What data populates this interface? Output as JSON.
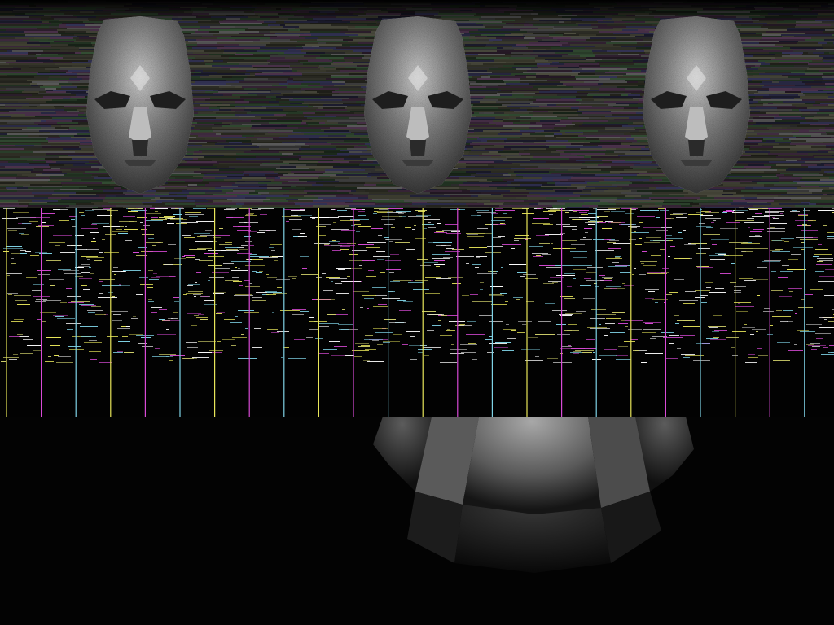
{
  "scene": {
    "mask_count": 3,
    "stripe_colors": [
      "#e8e65a",
      "#d84ad6",
      "#7fd3e6"
    ],
    "noise_colors": [
      "#5a5a4a",
      "#3c5a3c",
      "#5a3c5a",
      "#3c3c64",
      "#6a6a6a",
      "#4a4a3a"
    ],
    "spotlight_color": "#bdbdbd"
  }
}
